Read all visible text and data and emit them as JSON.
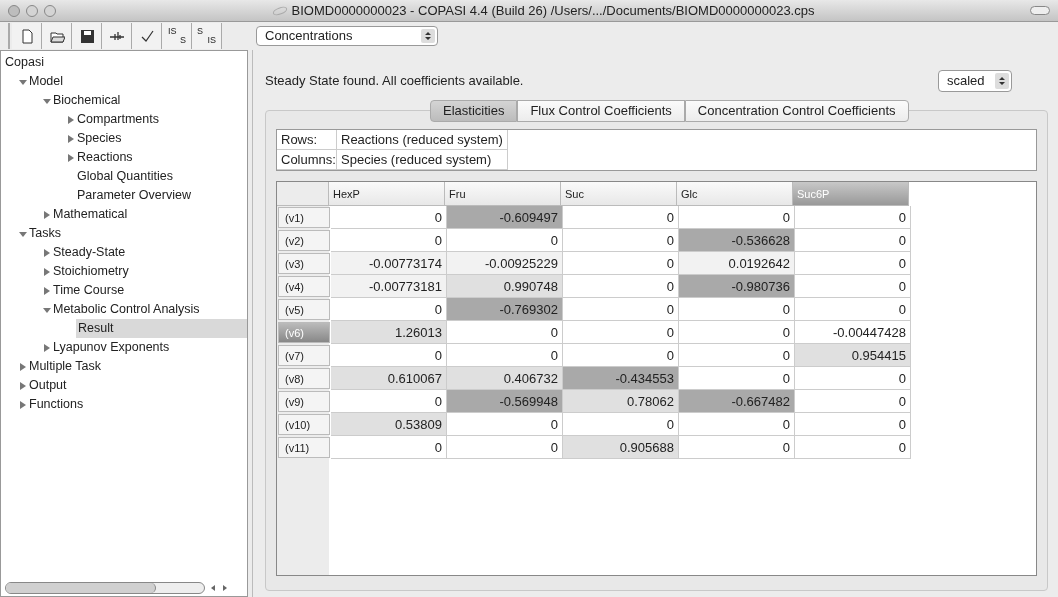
{
  "window": {
    "title": "BIOMD0000000023 - COPASI 4.4 (Build 26) /Users/.../Documents/BIOMD0000000023.cps"
  },
  "toolbar": {
    "buttons": [
      {
        "kind": "new"
      },
      {
        "kind": "open"
      },
      {
        "kind": "save"
      },
      {
        "kind": "slider"
      },
      {
        "kind": "check"
      },
      {
        "kind": "is_to_s",
        "label_top": "IS",
        "label_bottom": "S"
      },
      {
        "kind": "s_to_is",
        "label_top": "S",
        "label_bottom": "IS"
      }
    ],
    "select": {
      "value": "Concentrations"
    }
  },
  "tree": [
    {
      "label": "Copasi",
      "kind": "leaf",
      "selected": false,
      "children": [
        {
          "label": "Model",
          "kind": "expandable",
          "expanded": true,
          "selected": false,
          "children": [
            {
              "label": "Biochemical",
              "kind": "expandable",
              "expanded": true,
              "selected": false,
              "children": [
                {
                  "label": "Compartments",
                  "kind": "expandable",
                  "expanded": false,
                  "selected": false
                },
                {
                  "label": "Species",
                  "kind": "expandable",
                  "expanded": false,
                  "selected": false
                },
                {
                  "label": "Reactions",
                  "kind": "expandable",
                  "expanded": false,
                  "selected": false
                },
                {
                  "label": "Global Quantities",
                  "kind": "leaf",
                  "selected": false
                },
                {
                  "label": "Parameter Overview",
                  "kind": "leaf",
                  "selected": false
                }
              ]
            },
            {
              "label": "Mathematical",
              "kind": "expandable",
              "expanded": false,
              "selected": false
            }
          ]
        },
        {
          "label": "Tasks",
          "kind": "expandable",
          "expanded": true,
          "selected": false,
          "children": [
            {
              "label": "Steady-State",
              "kind": "expandable",
              "expanded": false,
              "selected": false
            },
            {
              "label": "Stoichiometry",
              "kind": "expandable",
              "expanded": false,
              "selected": false
            },
            {
              "label": "Time Course",
              "kind": "expandable",
              "expanded": false,
              "selected": false
            },
            {
              "label": "Metabolic Control Analysis",
              "kind": "expandable",
              "expanded": true,
              "selected": false,
              "children": [
                {
                  "label": "Result",
                  "kind": "leaf",
                  "selected": true
                }
              ]
            },
            {
              "label": "Lyapunov Exponents",
              "kind": "expandable",
              "expanded": false,
              "selected": false
            }
          ]
        },
        {
          "label": "Multiple Task",
          "kind": "expandable",
          "expanded": false,
          "selected": false
        },
        {
          "label": "Output",
          "kind": "expandable",
          "expanded": false,
          "selected": false
        },
        {
          "label": "Functions",
          "kind": "expandable",
          "expanded": false,
          "selected": false
        }
      ]
    }
  ],
  "status_message": "Steady State found. All coefficients available.",
  "scaling_select": {
    "value": "scaled"
  },
  "tabs": [
    {
      "label": "Elasticities",
      "selected": true
    },
    {
      "label": "Flux Control Coefficients",
      "selected": false
    },
    {
      "label": "Concentration Control Coefficients",
      "selected": false
    }
  ],
  "info": [
    {
      "label": "Rows:",
      "value": "Reactions (reduced system)"
    },
    {
      "label": "Columns:",
      "value": "Species (reduced system)"
    }
  ],
  "table": {
    "columns": [
      {
        "label": "HexP",
        "selected": false
      },
      {
        "label": "Fru",
        "selected": false
      },
      {
        "label": "Suc",
        "selected": false
      },
      {
        "label": "Glc",
        "selected": false
      },
      {
        "label": "Suc6P",
        "selected": true
      }
    ],
    "rows": [
      {
        "label": "(v1)",
        "selected": false,
        "cells": [
          {
            "text": "0",
            "color": "#ffffff"
          },
          {
            "text": "-0.609497",
            "color": "#a9a9a9"
          },
          {
            "text": "0",
            "color": "#ffffff"
          },
          {
            "text": "0",
            "color": "#ffffff"
          },
          {
            "text": "0",
            "color": "#ffffff"
          }
        ]
      },
      {
        "label": "(v2)",
        "selected": false,
        "cells": [
          {
            "text": "0",
            "color": "#ffffff"
          },
          {
            "text": "0",
            "color": "#ffffff"
          },
          {
            "text": "0",
            "color": "#ffffff"
          },
          {
            "text": "-0.536628",
            "color": "#a9a9a9"
          },
          {
            "text": "0",
            "color": "#ffffff"
          }
        ]
      },
      {
        "label": "(v3)",
        "selected": false,
        "cells": [
          {
            "text": "-0.00773174",
            "color": "#f2f2f2"
          },
          {
            "text": "-0.00925229",
            "color": "#f2f2f2"
          },
          {
            "text": "0",
            "color": "#ffffff"
          },
          {
            "text": "0.0192642",
            "color": "#f2f2f2"
          },
          {
            "text": "0",
            "color": "#ffffff"
          }
        ]
      },
      {
        "label": "(v4)",
        "selected": false,
        "cells": [
          {
            "text": "-0.00773181",
            "color": "#f2f2f2"
          },
          {
            "text": "0.990748",
            "color": "#e0e0e0"
          },
          {
            "text": "0",
            "color": "#ffffff"
          },
          {
            "text": "-0.980736",
            "color": "#a9a9a9"
          },
          {
            "text": "0",
            "color": "#ffffff"
          }
        ]
      },
      {
        "label": "(v5)",
        "selected": false,
        "cells": [
          {
            "text": "0",
            "color": "#ffffff"
          },
          {
            "text": "-0.769302",
            "color": "#a9a9a9"
          },
          {
            "text": "0",
            "color": "#ffffff"
          },
          {
            "text": "0",
            "color": "#ffffff"
          },
          {
            "text": "0",
            "color": "#ffffff"
          }
        ]
      },
      {
        "label": "(v6)",
        "selected": true,
        "cells": [
          {
            "text": "1.26013",
            "color": "#e0e0e0"
          },
          {
            "text": "0",
            "color": "#ffffff"
          },
          {
            "text": "0",
            "color": "#ffffff"
          },
          {
            "text": "0",
            "color": "#ffffff"
          },
          {
            "text": "-0.00447428",
            "color": "#ffffff"
          }
        ]
      },
      {
        "label": "(v7)",
        "selected": false,
        "cells": [
          {
            "text": "0",
            "color": "#ffffff"
          },
          {
            "text": "0",
            "color": "#ffffff"
          },
          {
            "text": "0",
            "color": "#ffffff"
          },
          {
            "text": "0",
            "color": "#ffffff"
          },
          {
            "text": "0.954415",
            "color": "#e0e0e0"
          }
        ]
      },
      {
        "label": "(v8)",
        "selected": false,
        "cells": [
          {
            "text": "0.610067",
            "color": "#e0e0e0"
          },
          {
            "text": "0.406732",
            "color": "#e0e0e0"
          },
          {
            "text": "-0.434553",
            "color": "#a9a9a9"
          },
          {
            "text": "0",
            "color": "#ffffff"
          },
          {
            "text": "0",
            "color": "#ffffff"
          }
        ]
      },
      {
        "label": "(v9)",
        "selected": false,
        "cells": [
          {
            "text": "0",
            "color": "#ffffff"
          },
          {
            "text": "-0.569948",
            "color": "#a9a9a9"
          },
          {
            "text": "0.78062",
            "color": "#e0e0e0"
          },
          {
            "text": "-0.667482",
            "color": "#a9a9a9"
          },
          {
            "text": "0",
            "color": "#ffffff"
          }
        ]
      },
      {
        "label": "(v10)",
        "selected": false,
        "cells": [
          {
            "text": "0.53809",
            "color": "#e0e0e0"
          },
          {
            "text": "0",
            "color": "#ffffff"
          },
          {
            "text": "0",
            "color": "#ffffff"
          },
          {
            "text": "0",
            "color": "#ffffff"
          },
          {
            "text": "0",
            "color": "#ffffff"
          }
        ]
      },
      {
        "label": "(v11)",
        "selected": false,
        "cells": [
          {
            "text": "0",
            "color": "#ffffff"
          },
          {
            "text": "0",
            "color": "#ffffff"
          },
          {
            "text": "0.905688",
            "color": "#e0e0e0"
          },
          {
            "text": "0",
            "color": "#ffffff"
          },
          {
            "text": "0",
            "color": "#ffffff"
          }
        ]
      }
    ]
  }
}
